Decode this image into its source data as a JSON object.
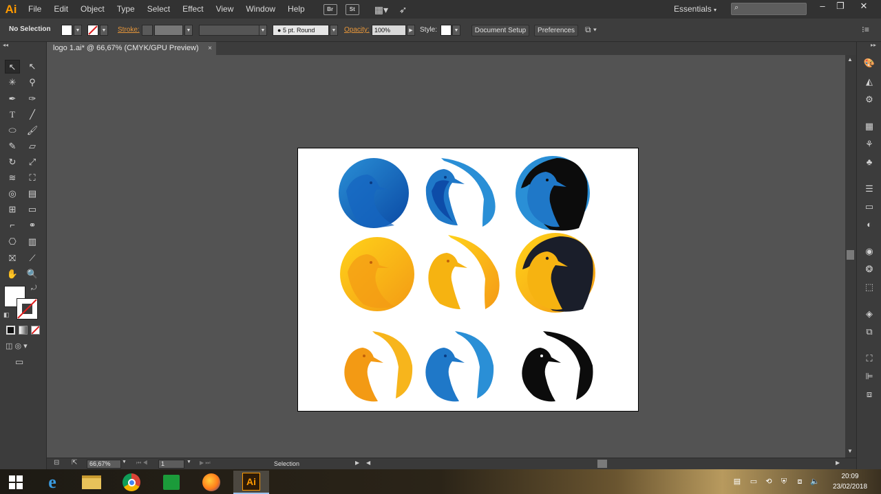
{
  "app": {
    "logo": "Ai",
    "workspace": "Essentials"
  },
  "menu": [
    "File",
    "Edit",
    "Object",
    "Type",
    "Select",
    "Effect",
    "View",
    "Window",
    "Help"
  ],
  "menubar_icons": {
    "bridge": "Br",
    "stock": "St"
  },
  "control": {
    "selection": "No Selection",
    "stroke_label": "Stroke:",
    "brush": "5 pt. Round",
    "opacity_label": "Opacity:",
    "opacity_value": "100%",
    "style_label": "Style:",
    "document_setup": "Document Setup",
    "preferences": "Preferences"
  },
  "tab": {
    "title": "logo 1.ai* @ 66,67% (CMYK/GPU Preview)",
    "close": "×"
  },
  "status": {
    "zoom": "66,67%",
    "artboard": "1",
    "tool": "Selection"
  },
  "taskbar": {
    "time": "20:09",
    "date": "23/02/2018",
    "illustrator_label": "Ai"
  },
  "colors": {
    "blue": "#1e7fc9",
    "blue_dark": "#0a4aa6",
    "yellow": "#f6b311",
    "orange": "#f39b16",
    "black": "#0c0c0c",
    "accent": "#ff9a00"
  },
  "artwork": {
    "logos": [
      {
        "style": "solid-circle",
        "color": "blue"
      },
      {
        "style": "outline-bird",
        "color": "blue"
      },
      {
        "style": "black-circle",
        "color": "blue"
      },
      {
        "style": "solid-circle",
        "color": "yellow"
      },
      {
        "style": "outline-bird",
        "color": "yellow"
      },
      {
        "style": "black-circle",
        "color": "yellow"
      },
      {
        "style": "outline-bird",
        "color": "orange"
      },
      {
        "style": "outline-bird",
        "color": "blue"
      },
      {
        "style": "outline-bird",
        "color": "black"
      }
    ]
  }
}
